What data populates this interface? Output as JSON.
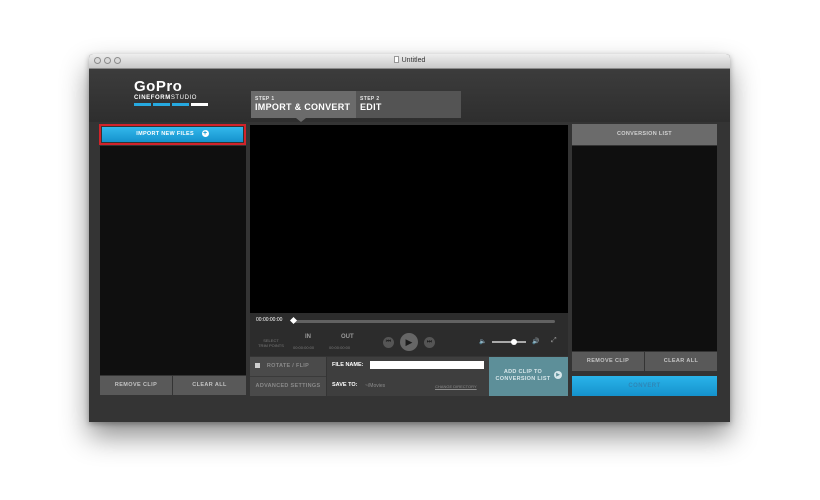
{
  "window": {
    "title": "Untitled"
  },
  "logo": {
    "brand": "GoPro",
    "product_bold": "CINEFORM",
    "product_thin": "STUDIO"
  },
  "steps": [
    {
      "num": "STEP 1",
      "label": "IMPORT & CONVERT"
    },
    {
      "num": "STEP 2",
      "label": "EDIT"
    }
  ],
  "left_panel": {
    "import_label": "IMPORT NEW FILES",
    "remove_clip": "REMOVE CLIP",
    "clear_all": "CLEAR ALL"
  },
  "player": {
    "timecode": "00:00:00:00",
    "select_trim_line1": "SELECT",
    "select_trim_line2": "TRIM POINTS",
    "in_label": "IN",
    "out_label": "OUT",
    "in_time": "00:00:00:00",
    "out_time": "00:00:00:00",
    "volume_level": 0.65
  },
  "options": {
    "rotate_flip": "ROTATE / FLIP",
    "advanced_settings": "ADVANCED SETTINGS"
  },
  "file": {
    "file_name_label": "FILE NAME:",
    "file_name_value": "",
    "save_to_label": "SAVE TO:",
    "save_to_path": "~/Movies",
    "change_directory": "CHANGE DIRECTORY"
  },
  "add_clip": {
    "line1": "ADD CLIP TO",
    "line2": "CONVERSION LIST"
  },
  "right_panel": {
    "header": "CONVERSION LIST",
    "remove_clip": "REMOVE CLIP",
    "clear_all": "CLEAR ALL",
    "convert": "CONVERT"
  },
  "colors": {
    "accent_blue": "#1aa0d8",
    "highlight_red": "#d2232a",
    "teal": "#5d8f99"
  },
  "icons": [
    "plus-circle-icon",
    "prev-icon",
    "play-icon",
    "next-icon",
    "volume-low-icon",
    "volume-high-icon",
    "fullscreen-icon",
    "play-circle-icon",
    "document-icon"
  ]
}
